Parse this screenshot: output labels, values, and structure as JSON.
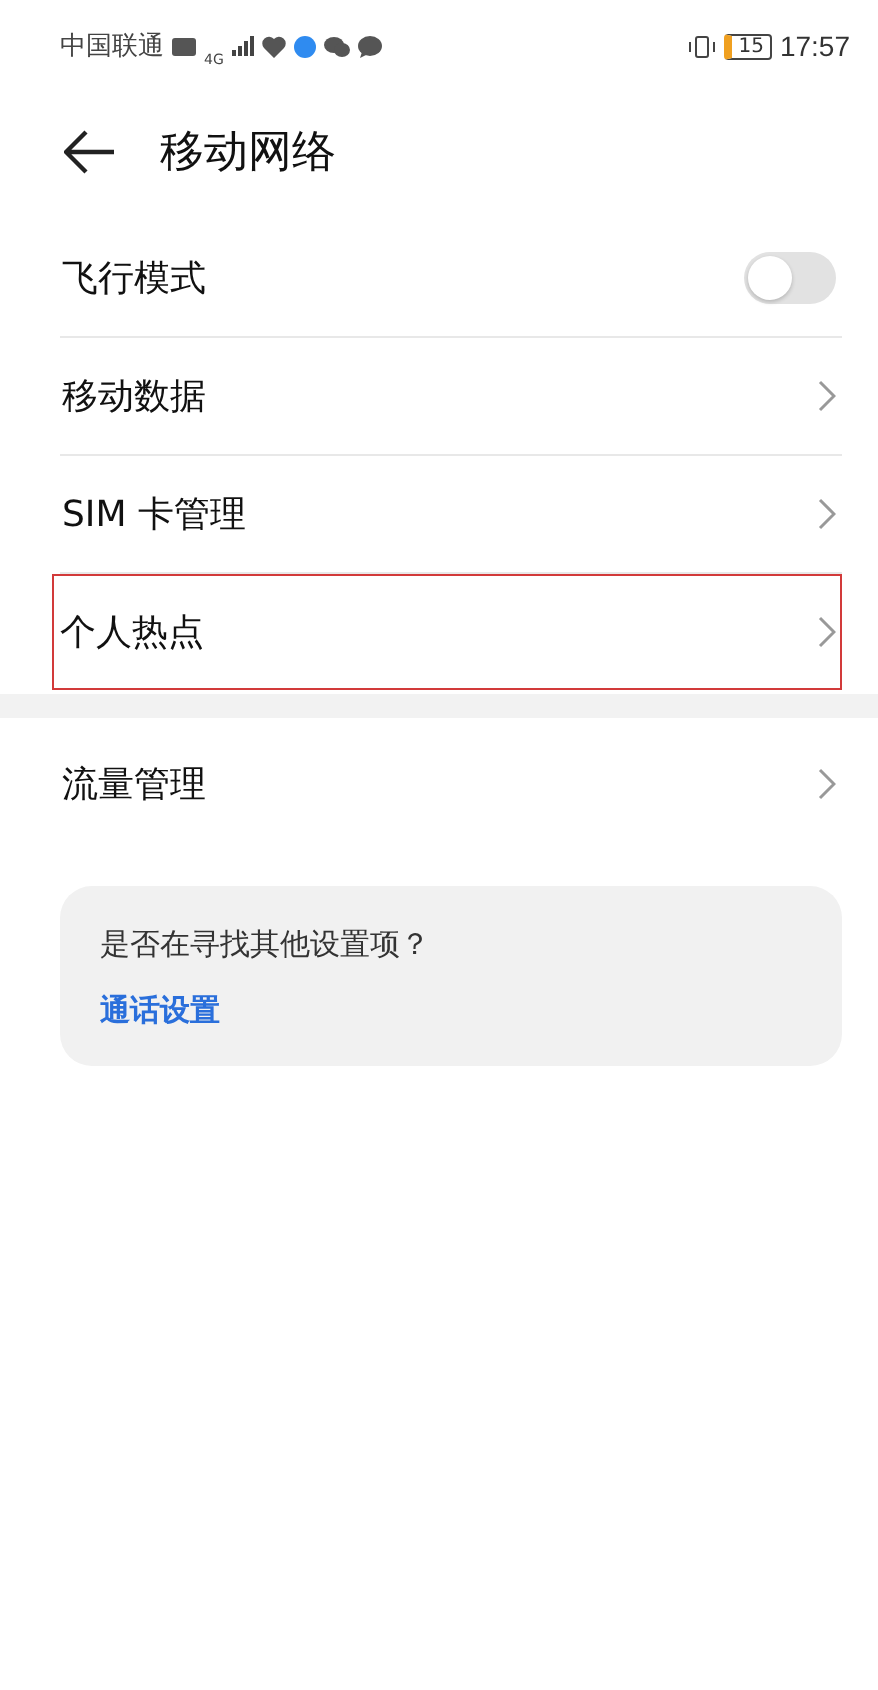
{
  "status_bar": {
    "carrier": "中国联通",
    "network": "4G",
    "battery": "15",
    "time": "17:57"
  },
  "header": {
    "title": "移动网络"
  },
  "groups": [
    {
      "items": [
        {
          "label": "飞行模式",
          "kind": "toggle",
          "on": false,
          "highlighted": false
        },
        {
          "label": "移动数据",
          "kind": "link",
          "highlighted": false
        },
        {
          "label": "SIM 卡管理",
          "kind": "link",
          "highlighted": false
        },
        {
          "label": "个人热点",
          "kind": "link",
          "highlighted": true
        }
      ]
    },
    {
      "items": [
        {
          "label": "流量管理",
          "kind": "link",
          "highlighted": false
        }
      ]
    }
  ],
  "suggestion": {
    "question": "是否在寻找其他设置项？",
    "link": "通话设置"
  }
}
